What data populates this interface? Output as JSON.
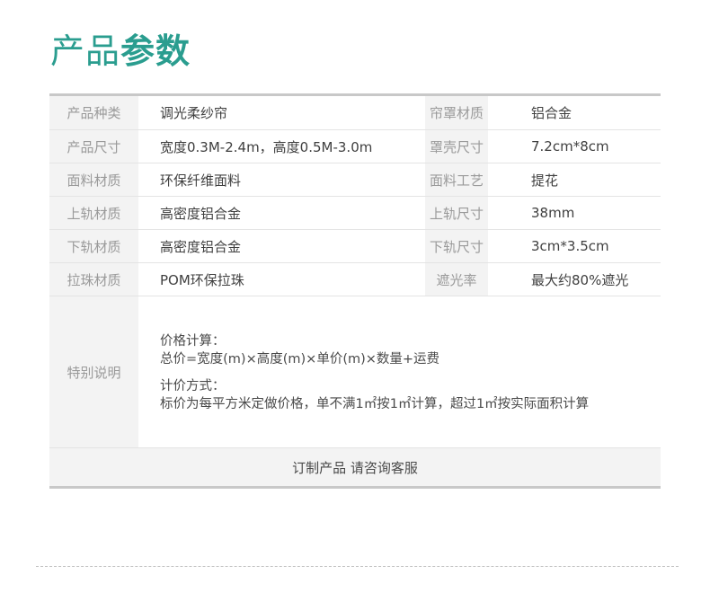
{
  "heading": {
    "light": "产品",
    "bold": "参数"
  },
  "rows": [
    {
      "label1": "产品种类",
      "value1": "调光柔纱帘",
      "label2": "帘罩材质",
      "value2": "铝合金"
    },
    {
      "label1": "产品尺寸",
      "value1": "宽度0.3M-2.4m，高度0.5M-3.0m",
      "label2": "罩壳尺寸",
      "value2": "7.2cm*8cm"
    },
    {
      "label1": "面料材质",
      "value1": "环保纤维面料",
      "label2": "面料工艺",
      "value2": "提花"
    },
    {
      "label1": "上轨材质",
      "value1": "高密度铝合金",
      "label2": "上轨尺寸",
      "value2": "38mm"
    },
    {
      "label1": "下轨材质",
      "value1": "高密度铝合金",
      "label2": "下轨尺寸",
      "value2": "3cm*3.5cm"
    },
    {
      "label1": "拉珠材质",
      "value1": "POM环保拉珠",
      "label2": "遮光率",
      "value2": "最大约80%遮光"
    }
  ],
  "special": {
    "label": "特别说明",
    "price_title": "价格计算：",
    "price_formula": "总价=宽度(m)×高度(m)×单价(m)×数量+运费",
    "method_title": "计价方式：",
    "method_text": "标价为每平方米定做价格，单不满1㎡按1㎡计算，超过1㎡按实际面积计算"
  },
  "footer": "订制产品 请咨询客服"
}
